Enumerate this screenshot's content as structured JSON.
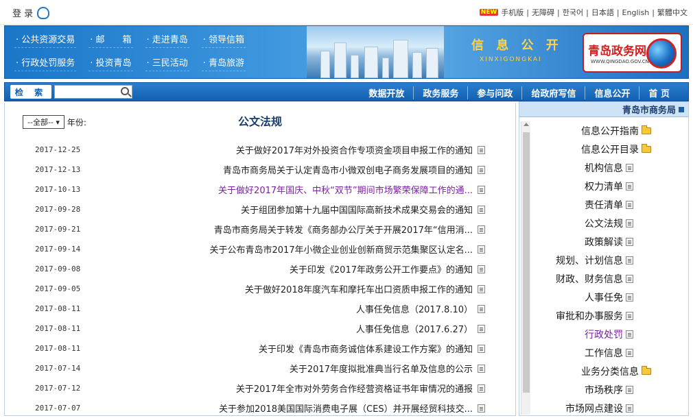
{
  "topbar": {
    "login_label": "登 录",
    "links": [
      "繁體中文",
      "English",
      "日本語",
      "한국어",
      "无障碍",
      "手机版"
    ],
    "new_badge": "NEW"
  },
  "banner": {
    "links": [
      "· 公共资源交易",
      "· 邮　　箱",
      "· 走进青岛",
      "· 领导信箱",
      "· 行政处罚服务",
      "· 投资青岛",
      "· 三民活动",
      "· 青岛旅游"
    ],
    "title": "信 息 公 开",
    "pinyin": "XINXIGONGKAI",
    "logo_title": "青岛政务网",
    "logo_sub": "WWW.QINGDAO.GOV.CN"
  },
  "navbar": {
    "search_button": "检 索",
    "search_placeholder": "",
    "menu": [
      "首 页",
      "信息公开",
      "给政府写信",
      "参与问政",
      "政务服务",
      "数据开放"
    ]
  },
  "main": {
    "title": "公文法规",
    "year_label": "年份:",
    "year_value": "--全部-- ▾",
    "items": [
      {
        "title": "关于做好2017年对外投资合作专项资金项目申报工作的通知",
        "date": "2017-12-25",
        "purple": false
      },
      {
        "title": "青岛市商务局关于认定青岛市小微双创电子商务发展项目的通知",
        "date": "2017-12-13",
        "purple": false
      },
      {
        "title": "关于做好2017年国庆、中秋“双节”期间市场繁荣保障工作的通...",
        "date": "2017-10-13",
        "purple": true
      },
      {
        "title": "关于组团参加第十九届中国国际高新技术成果交易会的通知",
        "date": "2017-09-28",
        "purple": false
      },
      {
        "title": "青岛市商务局关于转发《商务部办公厅关于开展2017年“信用消...",
        "date": "2017-09-21",
        "purple": false
      },
      {
        "title": "关于公布青岛市2017年小微企业创业创新商贸示范集聚区认定名...",
        "date": "2017-09-14",
        "purple": false
      },
      {
        "title": "关于印发《2017年政务公开工作要点》的通知",
        "date": "2017-09-08",
        "purple": false
      },
      {
        "title": "关于做好2018年度汽车和摩托车出口资质申报工作的通知",
        "date": "2017-09-05",
        "purple": false
      },
      {
        "title": "人事任免信息（2017.8.10）",
        "date": "2017-08-11",
        "purple": false
      },
      {
        "title": "人事任免信息（2017.6.27）",
        "date": "2017-08-11",
        "purple": false
      },
      {
        "title": "关于印发《青岛市商务诚信体系建设工作方案》的通知",
        "date": "2017-08-11",
        "purple": false
      },
      {
        "title": "关于2017年度拟批准典当行名单及信息的公示",
        "date": "2017-07-14",
        "purple": false
      },
      {
        "title": "关于2017年全市对外劳务合作经营资格证书年审情况的通报",
        "date": "2017-07-12",
        "purple": false
      },
      {
        "title": "关于参加2018美国国际消费电子展（CES）并开展经贸科技交...",
        "date": "2017-07-07",
        "purple": false
      }
    ]
  },
  "side": {
    "header": "青岛市商务局",
    "nodes": [
      {
        "label": "信息公开指南",
        "level": 1,
        "icon": "folder-icon",
        "purple": false
      },
      {
        "label": "信息公开目录",
        "level": 1,
        "icon": "folder-icon",
        "purple": false
      },
      {
        "label": "机构信息",
        "level": 2,
        "icon": "document-icon",
        "purple": false
      },
      {
        "label": "权力清单",
        "level": 2,
        "icon": "document-icon",
        "purple": false
      },
      {
        "label": "责任清单",
        "level": 2,
        "icon": "document-icon",
        "purple": false
      },
      {
        "label": "公文法规",
        "level": 2,
        "icon": "document-icon",
        "purple": false
      },
      {
        "label": "政策解读",
        "level": 2,
        "icon": "document-icon",
        "purple": false
      },
      {
        "label": "规划、计划信息",
        "level": 2,
        "icon": "document-icon",
        "purple": false
      },
      {
        "label": "财政、财务信息",
        "level": 2,
        "icon": "document-icon",
        "purple": false
      },
      {
        "label": "人事任免",
        "level": 2,
        "icon": "document-icon",
        "purple": false
      },
      {
        "label": "审批和办事服务",
        "level": 2,
        "icon": "document-icon",
        "purple": false
      },
      {
        "label": "行政处罚",
        "level": 2,
        "icon": "document-icon",
        "purple": true
      },
      {
        "label": "工作信息",
        "level": 2,
        "icon": "document-icon",
        "purple": false
      },
      {
        "label": "业务分类信息",
        "level": 1,
        "icon": "folder-icon",
        "purple": false
      },
      {
        "label": "市场秩序",
        "level": 2,
        "icon": "document-icon",
        "purple": false
      },
      {
        "label": "市场网点建设",
        "level": 2,
        "icon": "document-icon",
        "purple": false
      }
    ]
  }
}
